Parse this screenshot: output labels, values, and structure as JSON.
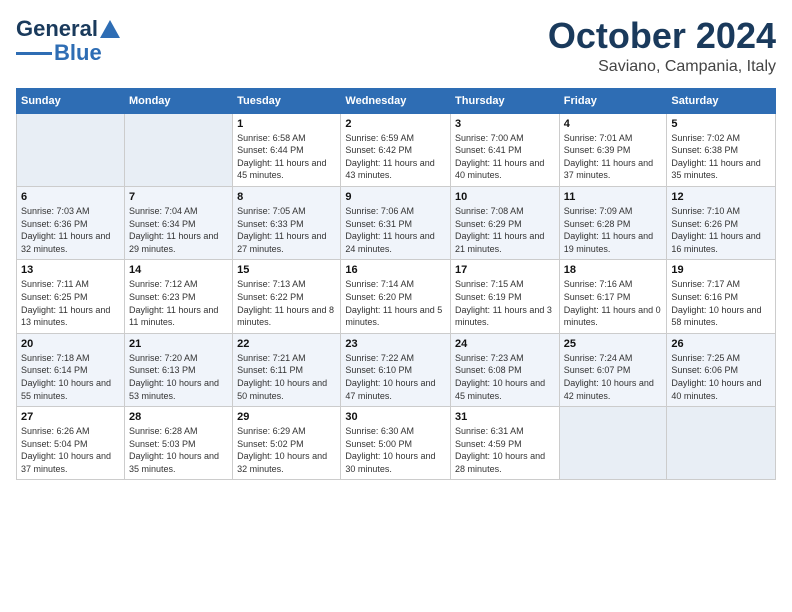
{
  "logo": {
    "line1": "General",
    "line2": "Blue"
  },
  "title": "October 2024",
  "location": "Saviano, Campania, Italy",
  "days_of_week": [
    "Sunday",
    "Monday",
    "Tuesday",
    "Wednesday",
    "Thursday",
    "Friday",
    "Saturday"
  ],
  "weeks": [
    [
      {
        "day": "",
        "sunrise": "",
        "sunset": "",
        "daylight": ""
      },
      {
        "day": "",
        "sunrise": "",
        "sunset": "",
        "daylight": ""
      },
      {
        "day": "1",
        "sunrise": "Sunrise: 6:58 AM",
        "sunset": "Sunset: 6:44 PM",
        "daylight": "Daylight: 11 hours and 45 minutes."
      },
      {
        "day": "2",
        "sunrise": "Sunrise: 6:59 AM",
        "sunset": "Sunset: 6:42 PM",
        "daylight": "Daylight: 11 hours and 43 minutes."
      },
      {
        "day": "3",
        "sunrise": "Sunrise: 7:00 AM",
        "sunset": "Sunset: 6:41 PM",
        "daylight": "Daylight: 11 hours and 40 minutes."
      },
      {
        "day": "4",
        "sunrise": "Sunrise: 7:01 AM",
        "sunset": "Sunset: 6:39 PM",
        "daylight": "Daylight: 11 hours and 37 minutes."
      },
      {
        "day": "5",
        "sunrise": "Sunrise: 7:02 AM",
        "sunset": "Sunset: 6:38 PM",
        "daylight": "Daylight: 11 hours and 35 minutes."
      }
    ],
    [
      {
        "day": "6",
        "sunrise": "Sunrise: 7:03 AM",
        "sunset": "Sunset: 6:36 PM",
        "daylight": "Daylight: 11 hours and 32 minutes."
      },
      {
        "day": "7",
        "sunrise": "Sunrise: 7:04 AM",
        "sunset": "Sunset: 6:34 PM",
        "daylight": "Daylight: 11 hours and 29 minutes."
      },
      {
        "day": "8",
        "sunrise": "Sunrise: 7:05 AM",
        "sunset": "Sunset: 6:33 PM",
        "daylight": "Daylight: 11 hours and 27 minutes."
      },
      {
        "day": "9",
        "sunrise": "Sunrise: 7:06 AM",
        "sunset": "Sunset: 6:31 PM",
        "daylight": "Daylight: 11 hours and 24 minutes."
      },
      {
        "day": "10",
        "sunrise": "Sunrise: 7:08 AM",
        "sunset": "Sunset: 6:29 PM",
        "daylight": "Daylight: 11 hours and 21 minutes."
      },
      {
        "day": "11",
        "sunrise": "Sunrise: 7:09 AM",
        "sunset": "Sunset: 6:28 PM",
        "daylight": "Daylight: 11 hours and 19 minutes."
      },
      {
        "day": "12",
        "sunrise": "Sunrise: 7:10 AM",
        "sunset": "Sunset: 6:26 PM",
        "daylight": "Daylight: 11 hours and 16 minutes."
      }
    ],
    [
      {
        "day": "13",
        "sunrise": "Sunrise: 7:11 AM",
        "sunset": "Sunset: 6:25 PM",
        "daylight": "Daylight: 11 hours and 13 minutes."
      },
      {
        "day": "14",
        "sunrise": "Sunrise: 7:12 AM",
        "sunset": "Sunset: 6:23 PM",
        "daylight": "Daylight: 11 hours and 11 minutes."
      },
      {
        "day": "15",
        "sunrise": "Sunrise: 7:13 AM",
        "sunset": "Sunset: 6:22 PM",
        "daylight": "Daylight: 11 hours and 8 minutes."
      },
      {
        "day": "16",
        "sunrise": "Sunrise: 7:14 AM",
        "sunset": "Sunset: 6:20 PM",
        "daylight": "Daylight: 11 hours and 5 minutes."
      },
      {
        "day": "17",
        "sunrise": "Sunrise: 7:15 AM",
        "sunset": "Sunset: 6:19 PM",
        "daylight": "Daylight: 11 hours and 3 minutes."
      },
      {
        "day": "18",
        "sunrise": "Sunrise: 7:16 AM",
        "sunset": "Sunset: 6:17 PM",
        "daylight": "Daylight: 11 hours and 0 minutes."
      },
      {
        "day": "19",
        "sunrise": "Sunrise: 7:17 AM",
        "sunset": "Sunset: 6:16 PM",
        "daylight": "Daylight: 10 hours and 58 minutes."
      }
    ],
    [
      {
        "day": "20",
        "sunrise": "Sunrise: 7:18 AM",
        "sunset": "Sunset: 6:14 PM",
        "daylight": "Daylight: 10 hours and 55 minutes."
      },
      {
        "day": "21",
        "sunrise": "Sunrise: 7:20 AM",
        "sunset": "Sunset: 6:13 PM",
        "daylight": "Daylight: 10 hours and 53 minutes."
      },
      {
        "day": "22",
        "sunrise": "Sunrise: 7:21 AM",
        "sunset": "Sunset: 6:11 PM",
        "daylight": "Daylight: 10 hours and 50 minutes."
      },
      {
        "day": "23",
        "sunrise": "Sunrise: 7:22 AM",
        "sunset": "Sunset: 6:10 PM",
        "daylight": "Daylight: 10 hours and 47 minutes."
      },
      {
        "day": "24",
        "sunrise": "Sunrise: 7:23 AM",
        "sunset": "Sunset: 6:08 PM",
        "daylight": "Daylight: 10 hours and 45 minutes."
      },
      {
        "day": "25",
        "sunrise": "Sunrise: 7:24 AM",
        "sunset": "Sunset: 6:07 PM",
        "daylight": "Daylight: 10 hours and 42 minutes."
      },
      {
        "day": "26",
        "sunrise": "Sunrise: 7:25 AM",
        "sunset": "Sunset: 6:06 PM",
        "daylight": "Daylight: 10 hours and 40 minutes."
      }
    ],
    [
      {
        "day": "27",
        "sunrise": "Sunrise: 6:26 AM",
        "sunset": "Sunset: 5:04 PM",
        "daylight": "Daylight: 10 hours and 37 minutes."
      },
      {
        "day": "28",
        "sunrise": "Sunrise: 6:28 AM",
        "sunset": "Sunset: 5:03 PM",
        "daylight": "Daylight: 10 hours and 35 minutes."
      },
      {
        "day": "29",
        "sunrise": "Sunrise: 6:29 AM",
        "sunset": "Sunset: 5:02 PM",
        "daylight": "Daylight: 10 hours and 32 minutes."
      },
      {
        "day": "30",
        "sunrise": "Sunrise: 6:30 AM",
        "sunset": "Sunset: 5:00 PM",
        "daylight": "Daylight: 10 hours and 30 minutes."
      },
      {
        "day": "31",
        "sunrise": "Sunrise: 6:31 AM",
        "sunset": "Sunset: 4:59 PM",
        "daylight": "Daylight: 10 hours and 28 minutes."
      },
      {
        "day": "",
        "sunrise": "",
        "sunset": "",
        "daylight": ""
      },
      {
        "day": "",
        "sunrise": "",
        "sunset": "",
        "daylight": ""
      }
    ]
  ]
}
